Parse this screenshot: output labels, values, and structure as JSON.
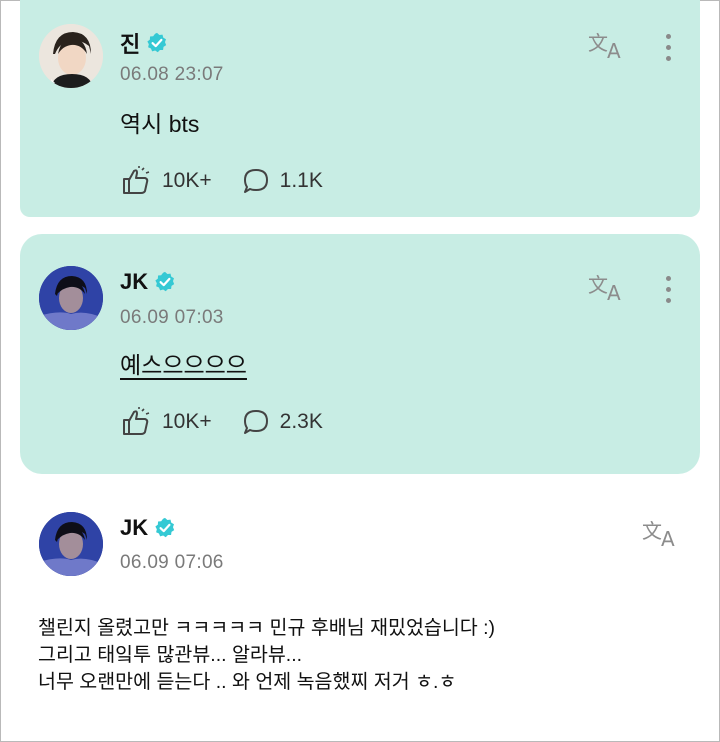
{
  "posts": [
    {
      "author": "진",
      "verified": true,
      "time": "06.08 23:07",
      "text": "역시 bts",
      "likes": "10K+",
      "comments": "1.1K",
      "highlighted": true
    },
    {
      "author": "JK",
      "verified": true,
      "time": "06.09 07:03",
      "text": "예스으으으으",
      "likes": "10K+",
      "comments": "2.3K",
      "highlighted": true
    },
    {
      "author": "JK",
      "verified": true,
      "time": "06.09 07:06",
      "lines": [
        "챌린지 올렸고만 ㅋㅋㅋㅋㅋ 민규 후배님 재밌었습니다 :)",
        "그리고 태잌투 많관뷰... 알라뷰...",
        "너무 오랜만에 듣는다 .. 와 언제 녹음했찌 저거 ㅎ.ㅎ"
      ],
      "highlighted": false
    }
  ],
  "colors": {
    "card_bg": "#c8ede4",
    "verified": "#35c9d4",
    "muted": "#7a7a7a"
  },
  "icons": {
    "translate": "translate-icon",
    "more": "more-vertical-icon",
    "like": "like-hand-icon",
    "comment": "comment-bubble-icon",
    "verified": "verified-check-icon"
  }
}
